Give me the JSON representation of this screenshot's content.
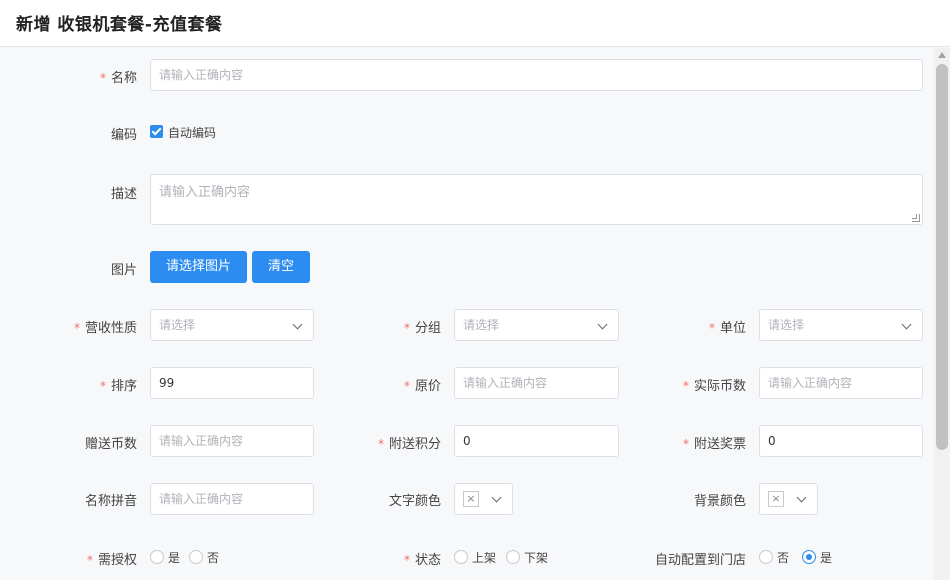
{
  "header": {
    "title": "新增 收银机套餐-充值套餐"
  },
  "form": {
    "name": {
      "label": "名称",
      "placeholder": "请输入正确内容"
    },
    "code": {
      "label": "编码",
      "auto_label": "自动编码",
      "auto_checked": true
    },
    "description": {
      "label": "描述",
      "placeholder": "请输入正确内容"
    },
    "image": {
      "label": "图片",
      "select_button": "请选择图片",
      "clear_button": "清空"
    },
    "revenue_type": {
      "label": "营收性质",
      "placeholder": "请选择"
    },
    "group": {
      "label": "分组",
      "placeholder": "请选择"
    },
    "unit": {
      "label": "单位",
      "placeholder": "请选择"
    },
    "sort": {
      "label": "排序",
      "value": "99"
    },
    "original_price": {
      "label": "原价",
      "placeholder": "请输入正确内容"
    },
    "actual_coins": {
      "label": "实际币数",
      "placeholder": "请输入正确内容"
    },
    "gift_coins": {
      "label": "赠送币数",
      "placeholder": "请输入正确内容"
    },
    "extra_points": {
      "label": "附送积分",
      "value": "0"
    },
    "extra_tickets": {
      "label": "附送奖票",
      "value": "0"
    },
    "name_pinyin": {
      "label": "名称拼音",
      "placeholder": "请输入正确内容"
    },
    "text_color": {
      "label": "文字颜色",
      "swatch_symbol": "×"
    },
    "bg_color": {
      "label": "背景颜色",
      "swatch_symbol": "×"
    },
    "needs_auth": {
      "label": "需授权",
      "options": [
        "是",
        "否"
      ],
      "selected": null
    },
    "status": {
      "label": "状态",
      "options": [
        "上架",
        "下架"
      ],
      "selected": null
    },
    "auto_config": {
      "label": "自动配置到门店",
      "options": [
        "否",
        "是"
      ],
      "selected": "是"
    }
  },
  "colors": {
    "primary": "#2d8cf0",
    "required": "#f56c6c",
    "border": "#dcdfe6"
  }
}
